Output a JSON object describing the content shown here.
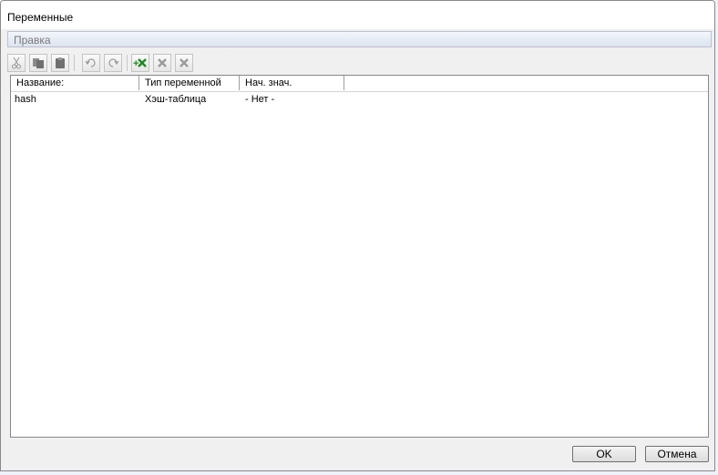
{
  "window": {
    "title": "Переменные"
  },
  "menu": {
    "items": [
      "Правка"
    ]
  },
  "toolbar": {
    "buttons": [
      {
        "icon": "cut-icon",
        "enabled": false
      },
      {
        "icon": "copy-icon",
        "enabled": false
      },
      {
        "icon": "paste-icon",
        "enabled": false
      },
      {
        "icon": "undo-icon",
        "enabled": false
      },
      {
        "icon": "redo-icon",
        "enabled": false
      },
      {
        "icon": "add-variable-icon",
        "enabled": true
      },
      {
        "icon": "delete-icon",
        "enabled": false
      },
      {
        "icon": "delete-all-icon",
        "enabled": false
      }
    ]
  },
  "table": {
    "columns": [
      "Название:",
      "Тип переменной",
      "Нач. знач."
    ],
    "rows": [
      {
        "name": "hash",
        "type": "Хэш-таблица",
        "initial": "- Нет -"
      }
    ]
  },
  "buttons": {
    "ok": "OK",
    "cancel": "Отмена"
  },
  "colors": {
    "add_icon": "#1e8a1e",
    "disabled_icon": "#9a9a9a"
  }
}
